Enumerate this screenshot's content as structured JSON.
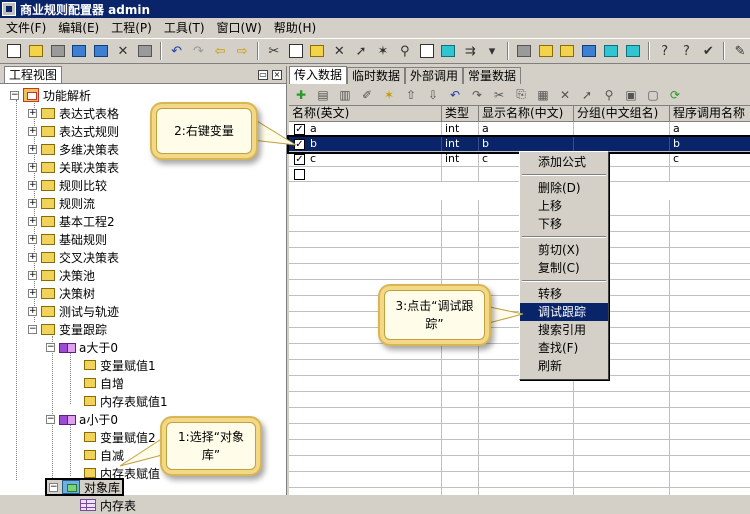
{
  "window": {
    "title": "商业规则配置器 admin"
  },
  "menu": [
    "文件(F)",
    "编辑(E)",
    "工程(P)",
    "工具(T)",
    "窗口(W)",
    "帮助(H)"
  ],
  "left_panel": {
    "tab": "工程视图",
    "root": "功能解析",
    "items": [
      "表达式表格",
      "表达式规则",
      "多维决策表",
      "关联决策表",
      "规则比较",
      "规则流",
      "基本工程2",
      "基础规则",
      "交叉决策表",
      "决策池",
      "决策树",
      "测试与轨迹",
      "变量跟踪"
    ],
    "group1": {
      "label": "a大于0",
      "children": [
        "变量赋值1",
        "自增",
        "内存表赋值1"
      ]
    },
    "group2": {
      "label": "a小于0",
      "children": [
        "变量赋值2",
        "自减",
        "内存表赋值"
      ]
    },
    "object_lib": "对象库",
    "memory_table": "内存表"
  },
  "right_panel": {
    "tabs": [
      "传入数据",
      "临时数据",
      "外部调用",
      "常量数据"
    ],
    "columns": [
      "名称(英文)",
      "类型",
      "显示名称(中文)",
      "分组(中文组名)",
      "程序调用名称"
    ],
    "rows": [
      {
        "name": "a",
        "type": "int",
        "display": "a",
        "group": "",
        "call": "a",
        "checked": true
      },
      {
        "name": "b",
        "type": "int",
        "display": "b",
        "group": "",
        "call": "b",
        "checked": true
      },
      {
        "name": "c",
        "type": "int",
        "display": "c",
        "group": "",
        "call": "c",
        "checked": true
      }
    ]
  },
  "context_menu": {
    "items": [
      "添加公式",
      "删除(D)",
      "上移",
      "下移",
      "剪切(X)",
      "复制(C)",
      "转移",
      "调试跟踪",
      "搜索引用",
      "查找(F)",
      "刷新"
    ],
    "highlighted": "调试跟踪"
  },
  "callouts": {
    "step1": "1:选择“对象库”",
    "step2": "2:右键变量",
    "step3": "3:点击“调试跟踪”"
  }
}
